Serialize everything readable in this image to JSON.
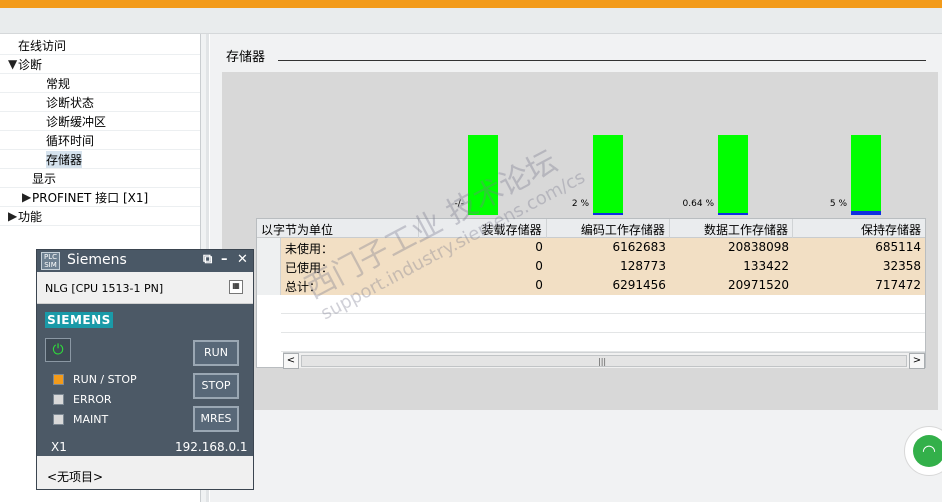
{
  "nav": {
    "items": [
      {
        "label": "在线访问",
        "indent": 0,
        "expander": ""
      },
      {
        "label": "诊断",
        "indent": 0,
        "expander": "▼"
      },
      {
        "label": "常规",
        "indent": 2,
        "expander": ""
      },
      {
        "label": "诊断状态",
        "indent": 2,
        "expander": ""
      },
      {
        "label": "诊断缓冲区",
        "indent": 2,
        "expander": ""
      },
      {
        "label": "循环时间",
        "indent": 2,
        "expander": ""
      },
      {
        "label": "存储器",
        "indent": 2,
        "expander": "",
        "selected": true
      },
      {
        "label": "显示",
        "indent": 1,
        "expander": ""
      },
      {
        "label": "PROFINET 接口 [X1]",
        "indent": 1,
        "expander": "▶"
      },
      {
        "label": "功能",
        "indent": 0,
        "expander": "▶"
      }
    ]
  },
  "section": {
    "title": "存储器"
  },
  "bars": [
    {
      "pct_label": "-/-",
      "used_fraction": 0.0
    },
    {
      "pct_label": "2 %",
      "used_fraction": 0.02
    },
    {
      "pct_label": "0.64 %",
      "used_fraction": 0.0064
    },
    {
      "pct_label": "5 %",
      "used_fraction": 0.05
    }
  ],
  "colors": {
    "free": "#00ff00",
    "used": "#1030e0",
    "accent": "#f39b1a",
    "row_bg": "#f2dfc4"
  },
  "table": {
    "headers": [
      "以字节为单位",
      "装载存储器",
      "编码工作存储器",
      "数据工作存储器",
      "保持存储器"
    ],
    "rows": [
      {
        "label": "未使用：",
        "load": "0",
        "code": "6162683",
        "data": "20838098",
        "retain": "685114"
      },
      {
        "label": "已使用：",
        "load": "0",
        "code": "128773",
        "data": "133422",
        "retain": "32358"
      },
      {
        "label": "总计：",
        "load": "0",
        "code": "6291456",
        "data": "20971520",
        "retain": "717472"
      }
    ],
    "scroll_left": "<",
    "scroll_right": ">",
    "scroll_grip": "|||"
  },
  "plcsim": {
    "logo": "PLC SIM",
    "title": "Siemens",
    "device": "NLG [CPU 1513-1 PN]",
    "brand": "SIEMENS",
    "power_glyph": "⏻",
    "leds": [
      {
        "label": "RUN / STOP",
        "color": "#f39b1a"
      },
      {
        "label": "ERROR",
        "color": "#d9d9d9"
      },
      {
        "label": "MAINT",
        "color": "#d9d9d9"
      }
    ],
    "buttons": {
      "run": "RUN",
      "stop": "STOP",
      "mres": "MRES"
    },
    "interface": "X1",
    "ip": "192.168.0.1",
    "project": "<无项目>"
  },
  "watermark": {
    "line1": "西门子工业 技术论坛",
    "line2": "support.industry.siemens.com/cs"
  }
}
